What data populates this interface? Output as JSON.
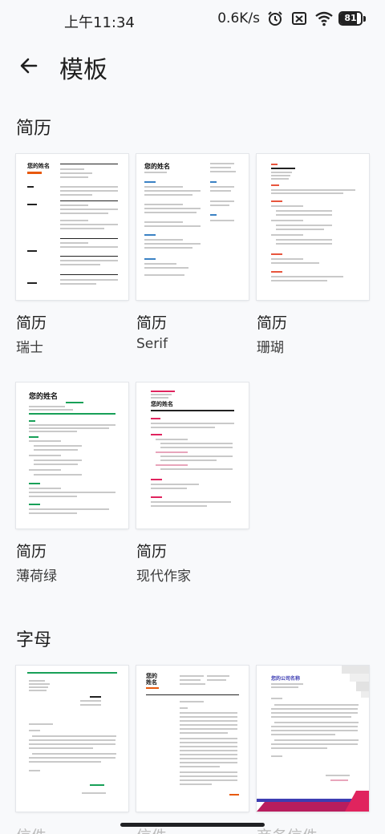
{
  "status_bar": {
    "time": "上午11:34",
    "net_speed": "0.6K/s",
    "battery_level": 81,
    "battery_text": "81",
    "icons": [
      "alarm-icon",
      "no-sim-icon",
      "wifi-icon",
      "battery-icon"
    ]
  },
  "app_bar": {
    "back_icon": "back-arrow-icon",
    "title": "模板"
  },
  "sections": [
    {
      "title": "简历",
      "templates": [
        {
          "type": "简历",
          "name": "瑞士",
          "accent": "#e8590c"
        },
        {
          "type": "简历",
          "name": "Serif",
          "accent": "#3b82c4"
        },
        {
          "type": "简历",
          "name": "珊瑚",
          "accent": "#e8553d"
        },
        {
          "type": "简历",
          "name": "薄荷绿",
          "accent": "#18a058"
        },
        {
          "type": "简历",
          "name": "现代作家",
          "accent": "#e0245e"
        }
      ]
    },
    {
      "title": "字母",
      "templates": [
        {
          "type": "信件",
          "accent": "#18a058"
        },
        {
          "type": "信件",
          "accent": "#e8590c"
        },
        {
          "type": "商务信件",
          "accent": "#3d3db3"
        }
      ]
    }
  ],
  "thumb_text": {
    "your_name": "您的姓名",
    "your_name_split_1": "您的",
    "your_name_split_2": "姓名",
    "company_name": "您的公司名称"
  }
}
